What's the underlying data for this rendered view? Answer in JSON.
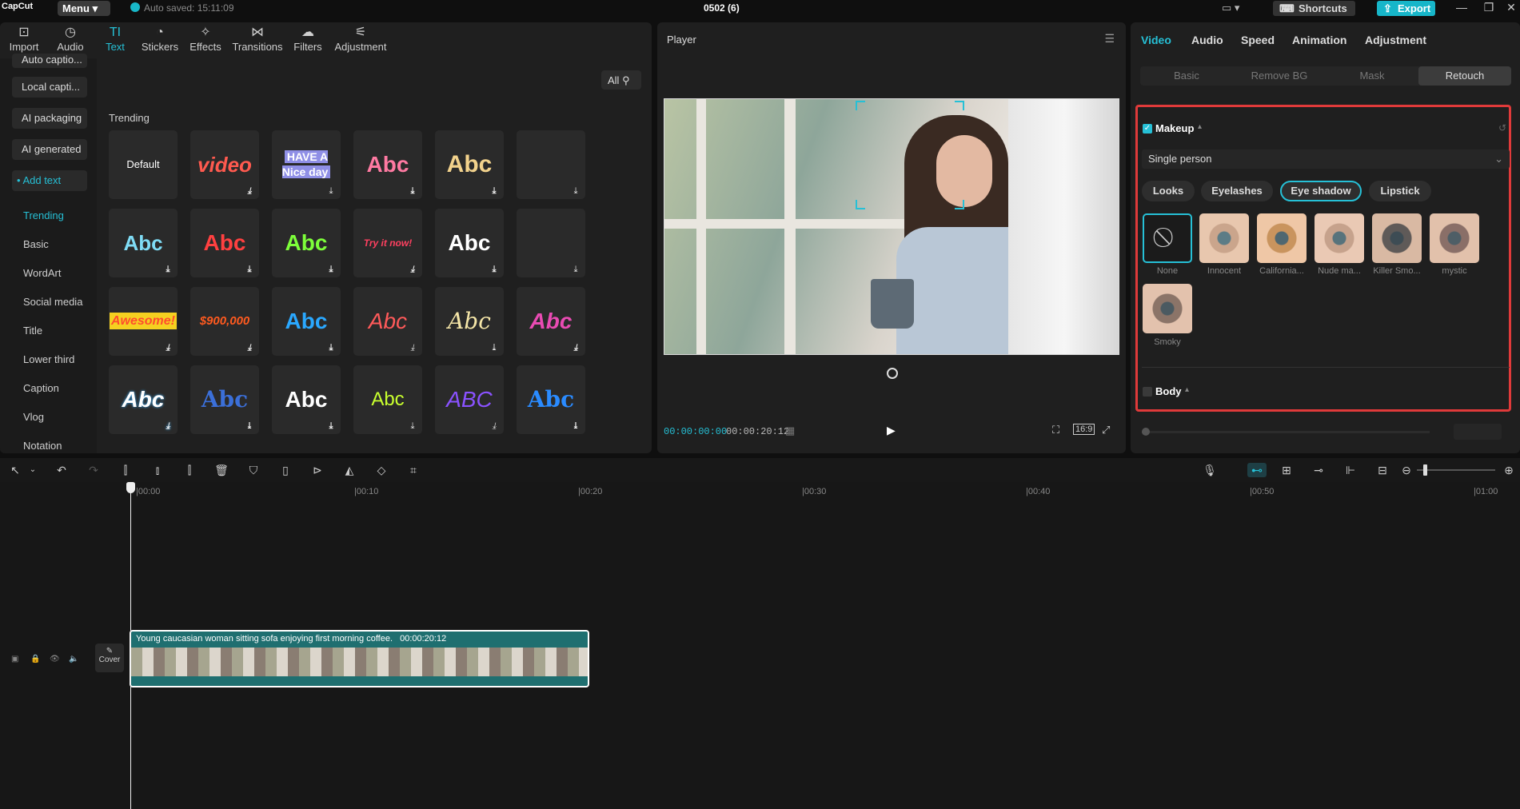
{
  "app": {
    "logo": "CapCut",
    "menu_label": "Menu",
    "autosave": "Auto saved: 15:11:09",
    "project_title": "0502 (6)",
    "shortcuts_label": "Shortcuts",
    "export_label": "Export",
    "accent_color": "#26c0d6",
    "highlight_color": "#e03a3a"
  },
  "toolbar": {
    "tabs": [
      {
        "label": "Import",
        "icon": "import-icon"
      },
      {
        "label": "Audio",
        "icon": "audio-icon"
      },
      {
        "label": "Text",
        "icon": "text-icon"
      },
      {
        "label": "Stickers",
        "icon": "stickers-icon"
      },
      {
        "label": "Effects",
        "icon": "effects-icon"
      },
      {
        "label": "Transitions",
        "icon": "transitions-icon"
      },
      {
        "label": "Filters",
        "icon": "filters-icon"
      },
      {
        "label": "Adjustment",
        "icon": "adjustment-icon"
      }
    ],
    "active_tab": "Text"
  },
  "sidebar": {
    "buttons": [
      "Auto captio...",
      "Local capti...",
      "AI packaging",
      "AI generated",
      "Add text"
    ],
    "items": [
      "Trending",
      "Basic",
      "WordArt",
      "Social media",
      "Title",
      "Lower third",
      "Caption",
      "Vlog",
      "Notation"
    ]
  },
  "text_panel": {
    "filter_label": "All",
    "section": "Trending",
    "tiles": [
      [
        "Default",
        "video",
        "HAVE A Nice day",
        "Abc",
        "Abc",
        ""
      ],
      [
        "Abc",
        "Abc",
        "Abc",
        "Try it now!",
        "Abc",
        ""
      ],
      [
        "Awesome!",
        "$900,000",
        "Abc",
        "Abc",
        "Abc",
        "Abc"
      ],
      [
        "Abc",
        "Abc",
        "Abc",
        "Abc",
        "ABC",
        "Abc"
      ]
    ]
  },
  "player": {
    "title": "Player",
    "current_time": "00:00:00:00",
    "total_time": "00:00:20:12",
    "ratio": "16:9"
  },
  "inspector": {
    "tabs": [
      "Video",
      "Audio",
      "Speed",
      "Animation",
      "Adjustment"
    ],
    "subtabs": [
      "Basic",
      "Remove BG",
      "Mask",
      "Retouch"
    ],
    "makeup_label": "Makeup",
    "mode_value": "Single person",
    "categories": [
      "Looks",
      "Eyelashes",
      "Eye shadow",
      "Lipstick"
    ],
    "presets": [
      "None",
      "Innocent",
      "California...",
      "Nude ma...",
      "Killer Smo...",
      "mystic",
      "Smoky"
    ],
    "body_label": "Body"
  },
  "timeline": {
    "ruler": [
      "00:00",
      "00:10",
      "00:20",
      "00:30",
      "00:40",
      "00:50",
      "01:00"
    ],
    "clip_title": "Young caucasian woman sitting sofa enjoying first morning coffee.",
    "clip_duration": "00:00:20:12",
    "cover_label": "Cover"
  }
}
